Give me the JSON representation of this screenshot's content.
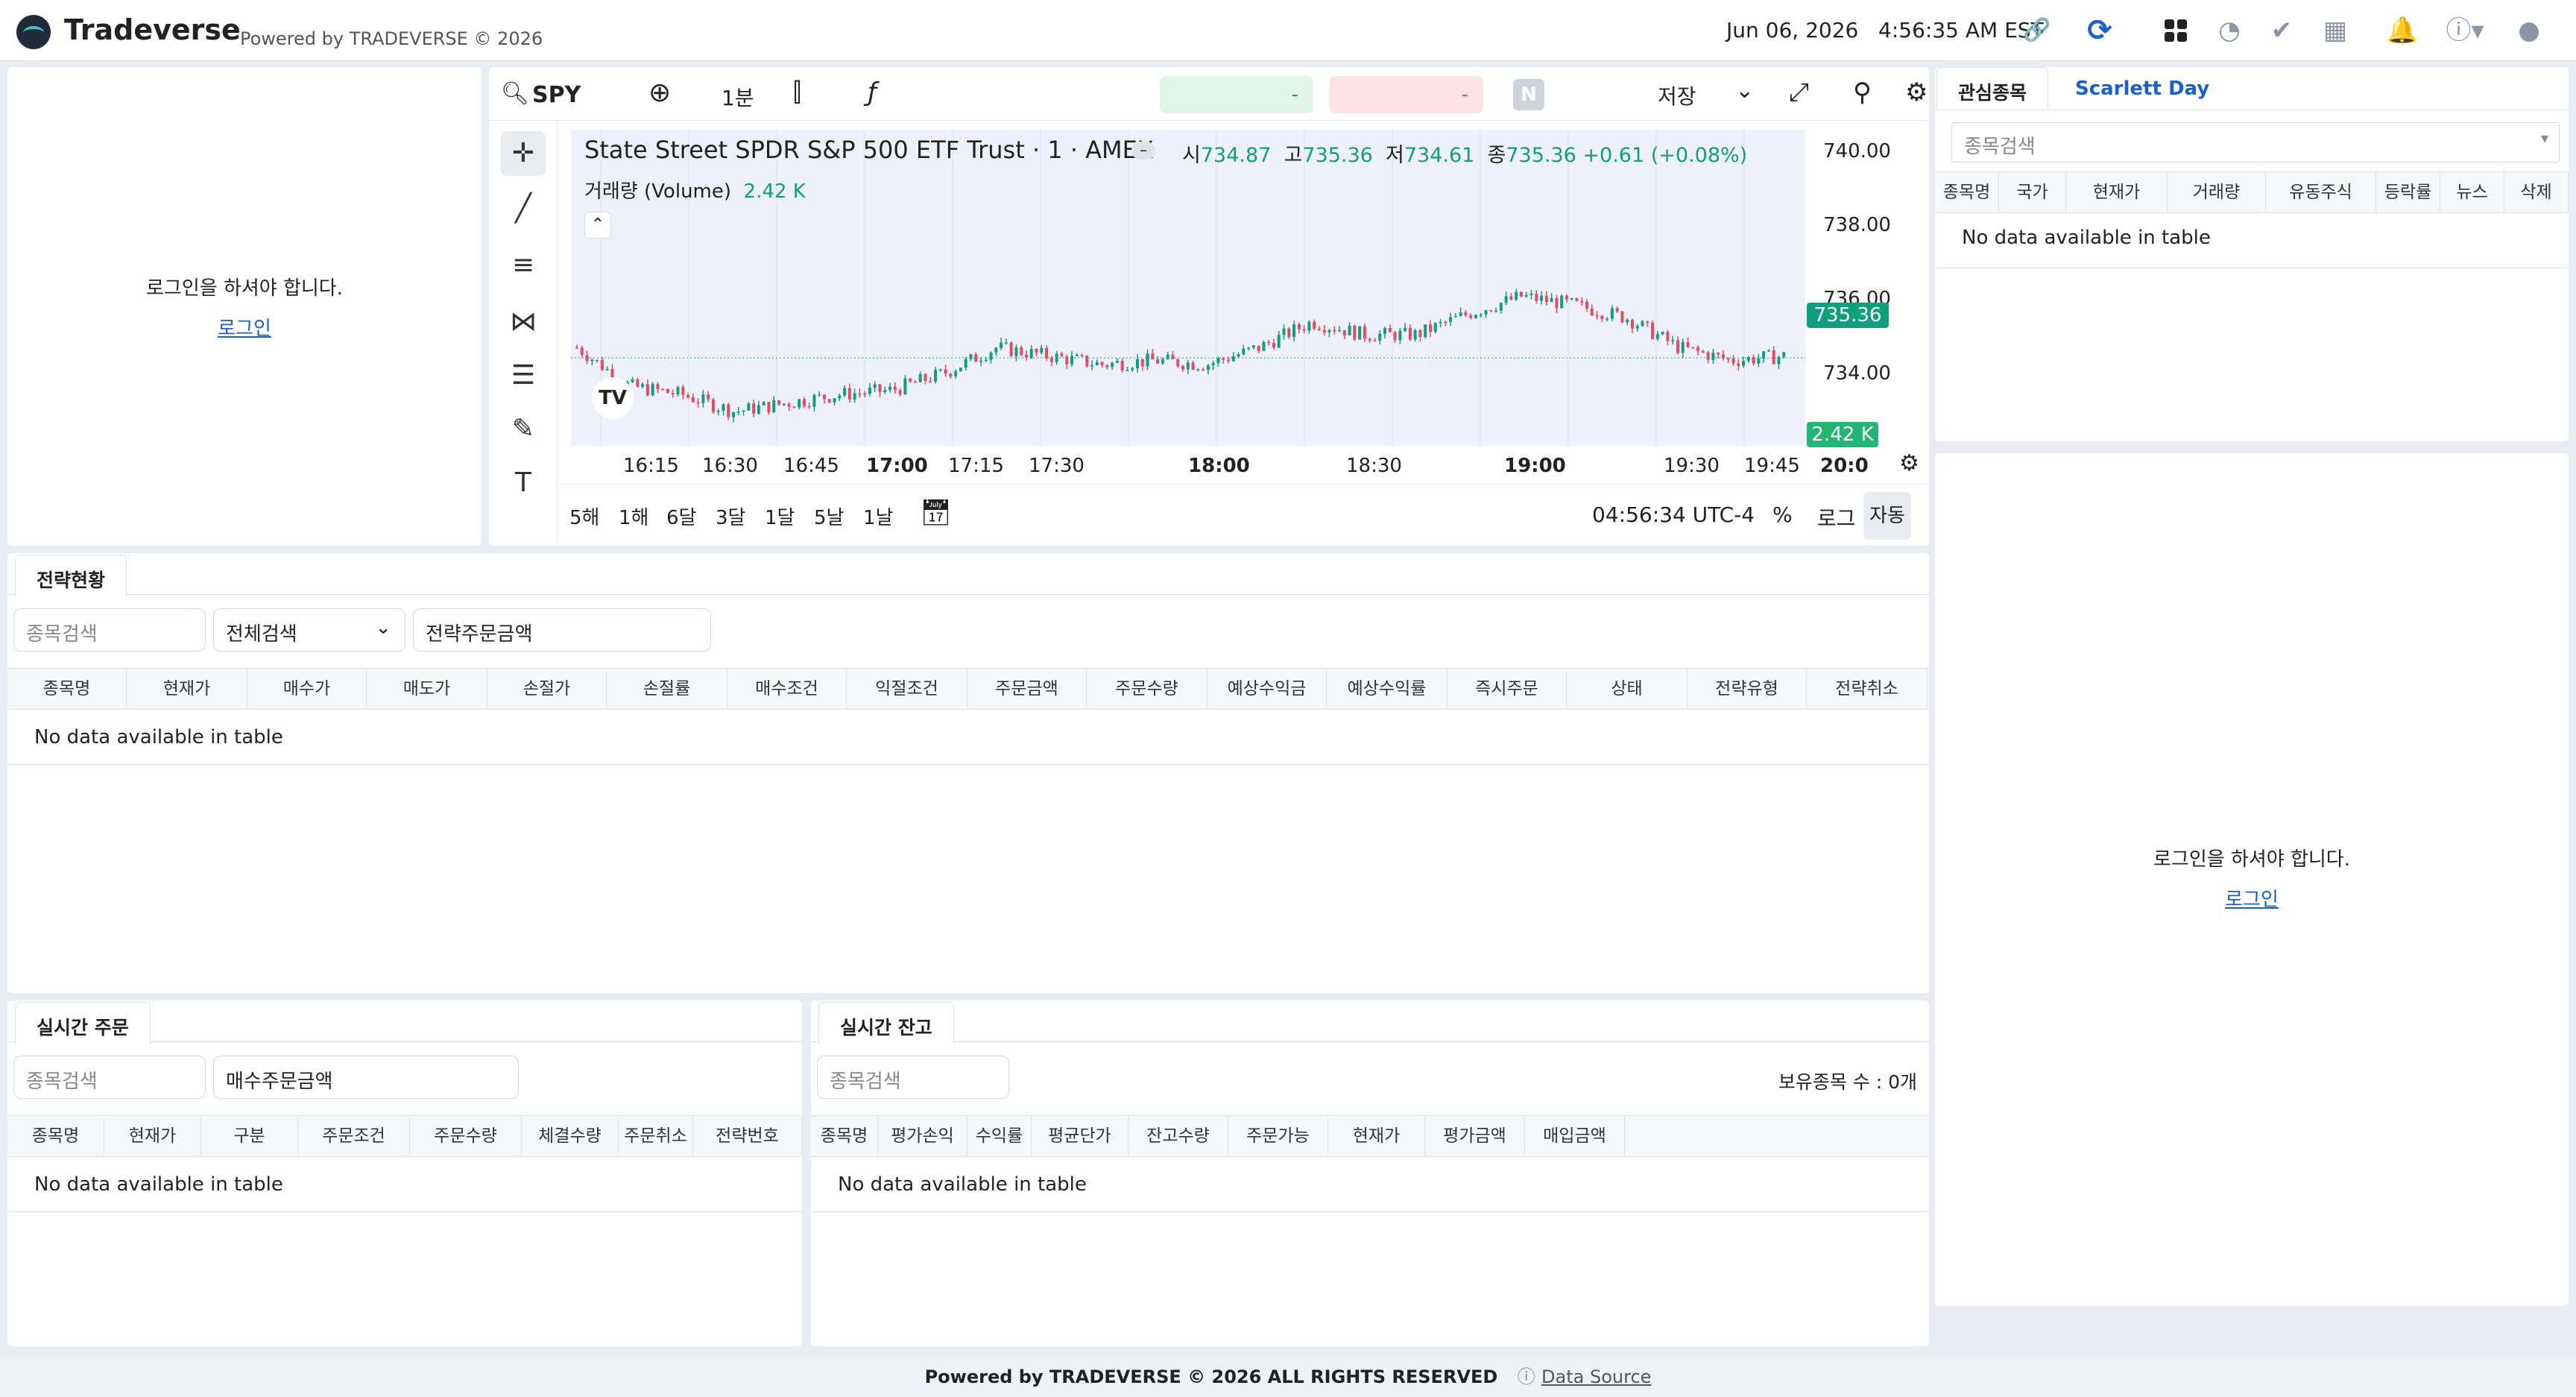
{
  "app": {
    "brand": "Tradeverse",
    "powered": "Powered by TRADEVERSE © 2026",
    "date": "Jun 06, 2026",
    "time": "4:56:35 AM EST"
  },
  "left_login": {
    "message": "로그인을 하셔야 합니다.",
    "link": "로그인"
  },
  "chart": {
    "symbol": "SPY",
    "interval": "1분",
    "save": "저장",
    "bid_value": "-",
    "ask_value": "-",
    "n_badge": "N",
    "title": "State Street SPDR S&P 500 ETF Trust · 1 · AMEX",
    "o_label": "시",
    "o": "734.87",
    "h_label": "고",
    "h": "735.36",
    "l_label": "저",
    "l": "734.61",
    "c_label": "종",
    "c": "735.36",
    "change": "+0.61 (+0.08%)",
    "volume_label": "거래량 (Volume)",
    "volume": "2.42 K",
    "price_tag": "735.36",
    "volume_tag": "2.42 K",
    "yticks": [
      "740.00",
      "738.00",
      "736.00",
      "734.00"
    ],
    "xticks": [
      "16:15",
      "16:30",
      "16:45",
      "17:00",
      "17:15",
      "17:30",
      "18:00",
      "18:30",
      "19:00",
      "19:30",
      "19:45",
      "20:0"
    ],
    "ranges": [
      "5해",
      "1해",
      "6달",
      "3달",
      "1달",
      "5날",
      "1날"
    ],
    "clock": "04:56:34 UTC-4",
    "pct": "%",
    "log": "로그",
    "auto": "자동",
    "colors": {
      "up": "#0e9f7e",
      "down": "#e84a5f",
      "bg": "#eef0fb"
    }
  },
  "chart_data": {
    "type": "candlestick",
    "title": "State Street SPDR S&P 500 ETF Trust · 1 · AMEX",
    "ylim": [
      733.3,
      740.7
    ],
    "x": [
      "16:10",
      "16:20",
      "16:30",
      "16:40",
      "16:50",
      "17:00",
      "17:10",
      "17:20",
      "17:30",
      "17:40",
      "17:50",
      "18:00",
      "18:10",
      "18:20",
      "18:30",
      "18:40",
      "18:50",
      "19:00",
      "19:10",
      "19:20",
      "19:30",
      "19:40",
      "19:50",
      "20:00"
    ],
    "close": [
      735.6,
      734.7,
      734.5,
      734.1,
      734.3,
      734.5,
      734.6,
      735.0,
      735.6,
      735.4,
      735.2,
      735.3,
      735.2,
      735.6,
      736.2,
      735.9,
      735.9,
      736.4,
      736.8,
      736.6,
      736.3,
      735.6,
      735.3,
      735.4
    ]
  },
  "strategy": {
    "tab": "전략현황",
    "search_ph": "종목검색",
    "select": "전체검색",
    "amount": "전략주문금액",
    "columns": [
      "종목명",
      "현재가",
      "매수가",
      "매도가",
      "손절가",
      "손절률",
      "매수조건",
      "익절조건",
      "주문금액",
      "주문수량",
      "예상수익금",
      "예상수익률",
      "즉시주문",
      "상태",
      "전략유형",
      "전략취소"
    ],
    "empty": "No data available in table"
  },
  "orders": {
    "tab": "실시간 주문",
    "search_ph": "종목검색",
    "amount": "매수주문금액",
    "columns": [
      "종목명",
      "현재가",
      "구분",
      "주문조건",
      "주문수량",
      "체결수량",
      "주문취소",
      "전략번호"
    ],
    "empty": "No data available in table"
  },
  "balance": {
    "tab": "실시간 잔고",
    "search_ph": "종목검색",
    "holdings": "보유종목 수 : 0개",
    "columns": [
      "종목명",
      "평가손익",
      "수익률",
      "평균단가",
      "잔고수량",
      "주문가능",
      "현재가",
      "평가금액",
      "매입금액"
    ],
    "empty": "No data available in table"
  },
  "watch": {
    "tab1": "관심종목",
    "tab2": "Scarlett Day",
    "search_ph": "종목검색",
    "columns": [
      "종목명",
      "국가",
      "현재가",
      "거래량",
      "유동주식",
      "등락률",
      "뉴스",
      "삭제"
    ],
    "empty": "No data available in table"
  },
  "right_login": {
    "message": "로그인을 하셔야 합니다.",
    "link": "로그인"
  },
  "footer": {
    "text": "Powered by TRADEVERSE © 2026 ALL RIGHTS RESERVED",
    "source": "Data Source"
  }
}
